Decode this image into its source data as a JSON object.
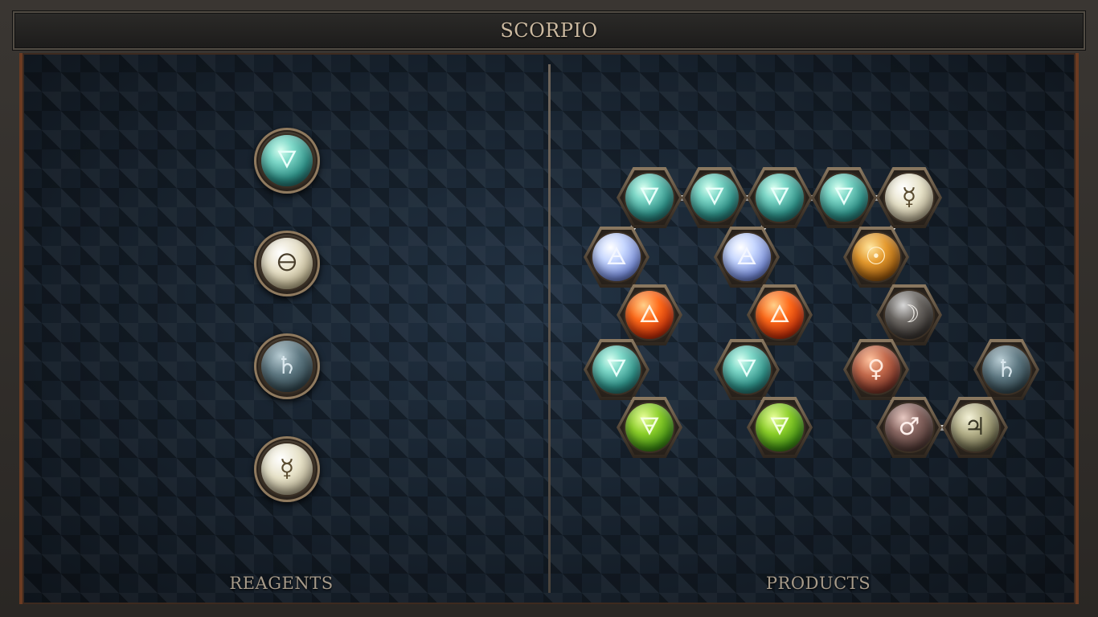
{
  "title": "SCORPIO",
  "labels": {
    "reagents": "REAGENTS",
    "products": "PRODUCTS"
  },
  "reagents": [
    {
      "element": "water",
      "symbol": "🜄"
    },
    {
      "element": "salt",
      "symbol": "🜔"
    },
    {
      "element": "lead",
      "symbol": "♄"
    },
    {
      "element": "quicksilver",
      "symbol": "☿"
    }
  ],
  "product": {
    "atoms": [
      {
        "element": "water",
        "symbol": "🜄"
      },
      {
        "element": "water",
        "symbol": "🜄"
      },
      {
        "element": "water",
        "symbol": "🜄"
      },
      {
        "element": "water",
        "symbol": "🜄"
      },
      {
        "element": "quicksilver",
        "symbol": "☿"
      },
      {
        "element": "air",
        "symbol": "🜁"
      },
      {
        "element": "air",
        "symbol": "🜁"
      },
      {
        "element": "gold",
        "symbol": "☉"
      },
      {
        "element": "fire",
        "symbol": "🜂"
      },
      {
        "element": "fire",
        "symbol": "🜂"
      },
      {
        "element": "silver",
        "symbol": "☽"
      },
      {
        "element": "water",
        "symbol": "🜄"
      },
      {
        "element": "water",
        "symbol": "🜄"
      },
      {
        "element": "copper",
        "symbol": "♀"
      },
      {
        "element": "lead",
        "symbol": "♄"
      },
      {
        "element": "earth",
        "symbol": "🜃"
      },
      {
        "element": "earth",
        "symbol": "🜃"
      },
      {
        "element": "iron",
        "symbol": "♂"
      },
      {
        "element": "tin",
        "symbol": "♃"
      }
    ],
    "bonds": [
      [
        0,
        1
      ],
      [
        1,
        2
      ],
      [
        2,
        3
      ],
      [
        3,
        4
      ],
      [
        0,
        5
      ],
      [
        2,
        6
      ],
      [
        4,
        7
      ],
      [
        5,
        8
      ],
      [
        6,
        9
      ],
      [
        7,
        10
      ],
      [
        8,
        11
      ],
      [
        9,
        12
      ],
      [
        10,
        13
      ],
      [
        11,
        15
      ],
      [
        12,
        16
      ],
      [
        13,
        17
      ],
      [
        17,
        18
      ],
      [
        18,
        14
      ]
    ]
  },
  "colors": {
    "frame": "#3a3632",
    "board": "#17212c",
    "accent_copper": "#6b3b22",
    "label_text": "#a79b8a",
    "title_text": "#cbb9a0"
  }
}
